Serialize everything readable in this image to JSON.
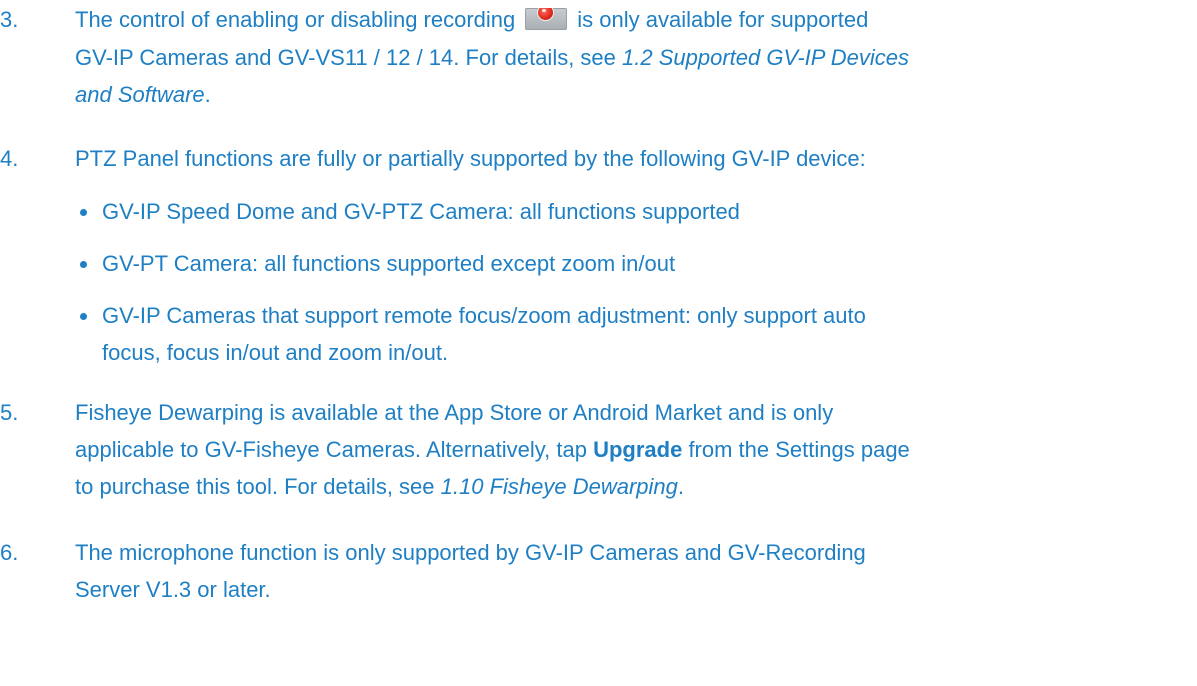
{
  "items": [
    {
      "number": "3.",
      "line1_a": "The control of enabling or disabling recording",
      "line1_b": "is only available for supported",
      "line2_a": "GV-IP Cameras and GV-VS11 / 12 / 14. For details, see ",
      "line2_ref": "1.2 Supported GV-IP Devices",
      "line3_ref": "and Software",
      "line3_end": "."
    },
    {
      "number": "4.",
      "text": "PTZ Panel functions are fully or partially supported by the following GV-IP device:",
      "bullets": [
        "GV-IP Speed Dome and GV-PTZ Camera: all functions supported",
        "GV-PT Camera: all functions supported except zoom in/out",
        "GV-IP Cameras that support remote focus/zoom adjustment: only support auto",
        "focus, focus in/out and zoom in/out."
      ]
    },
    {
      "number": "5.",
      "line1": "Fisheye Dewarping is available at the App Store or Android Market and is only",
      "line2_a": "applicable to GV-Fisheye Cameras. Alternatively, tap ",
      "line2_bold": "Upgrade",
      "line2_b": " from the Settings page",
      "line3_a": "to purchase this tool. For details, see ",
      "line3_ref": "1.10 Fisheye Dewarping",
      "line3_end": "."
    },
    {
      "number": "6.",
      "line1": "The microphone function is only supported by GV-IP Cameras and GV-Recording",
      "line2": "Server V1.3 or later."
    }
  ],
  "icons": {
    "record": "record-icon"
  },
  "colors": {
    "text": "#1e7fc4",
    "record_dot": "#d62012"
  }
}
